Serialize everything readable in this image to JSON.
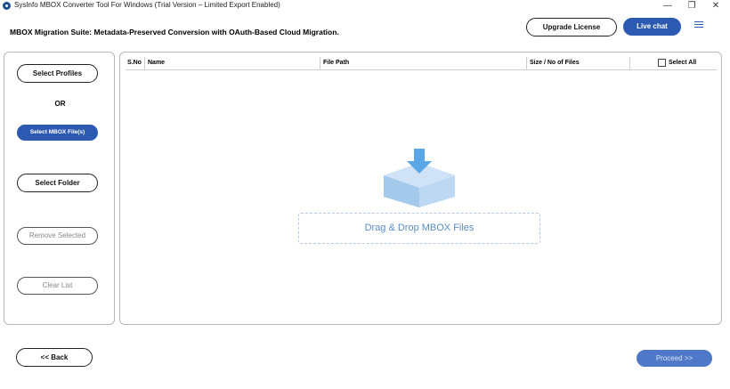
{
  "window": {
    "title": "SysInfo MBOX Converter Tool For Windows (Trial Version – Limited Export Enabled)",
    "minimize_glyph": "—",
    "restore_glyph": "❐",
    "close_glyph": "✕"
  },
  "header": {
    "suite_title": "MBOX Migration Suite: Metadata-Preserved Conversion with OAuth-Based Cloud Migration.",
    "upgrade_label": "Upgrade License",
    "live_chat_label": "Live chat",
    "menu_icon": "hamburger-menu-icon"
  },
  "left_panel": {
    "select_profiles_label": "Select Profiles",
    "or_label": "OR",
    "select_mbox_label": "Select MBOX File(s)",
    "select_folder_label": "Select Folder",
    "remove_selected_label": "Remove Selected",
    "clear_list_label": "Clear List"
  },
  "table": {
    "columns": [
      "S.No",
      "Name",
      "File Path",
      "Size / No of Files"
    ],
    "select_all_label": "Select All",
    "rows": []
  },
  "drop_zone": {
    "label": "Drag & Drop MBOX Files",
    "icon": "download-box-icon"
  },
  "footer": {
    "back_label": "<< Back",
    "proceed_label": "Proceed >>"
  },
  "colors": {
    "accent": "#2c5ab3",
    "accent_disabled": "#4f79c8",
    "drop_text": "#5a8cc2",
    "border": "#b8b8b8"
  }
}
